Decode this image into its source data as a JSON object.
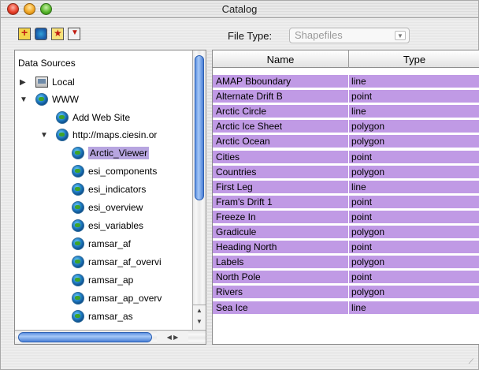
{
  "window": {
    "title": "Catalog"
  },
  "toolbar": {
    "icons": [
      "add-data-icon",
      "web-site-icon",
      "favorite-icon",
      "remove-icon"
    ],
    "file_type_label": "File Type:",
    "file_type_value": "Shapefiles"
  },
  "tree": {
    "header": "Data Sources",
    "items": [
      {
        "label": "Local",
        "depth": 0,
        "icon": "computer-icon",
        "disclosure": "collapsed"
      },
      {
        "label": "WWW",
        "depth": 0,
        "icon": "globe-icon",
        "disclosure": "expanded"
      },
      {
        "label": "Add Web Site",
        "depth": 1,
        "icon": "globe-icon",
        "disclosure": "none"
      },
      {
        "label": "http://maps.ciesin.or",
        "depth": 1,
        "icon": "globe-icon",
        "disclosure": "expanded"
      },
      {
        "label": "Arctic_Viewer",
        "depth": 2,
        "icon": "globe-icon",
        "disclosure": "none",
        "selected": true
      },
      {
        "label": "esi_components",
        "depth": 2,
        "icon": "globe-icon",
        "disclosure": "none"
      },
      {
        "label": "esi_indicators",
        "depth": 2,
        "icon": "globe-icon",
        "disclosure": "none"
      },
      {
        "label": "esi_overview",
        "depth": 2,
        "icon": "globe-icon",
        "disclosure": "none"
      },
      {
        "label": "esi_variables",
        "depth": 2,
        "icon": "globe-icon",
        "disclosure": "none"
      },
      {
        "label": "ramsar_af",
        "depth": 2,
        "icon": "globe-icon",
        "disclosure": "none"
      },
      {
        "label": "ramsar_af_overvi",
        "depth": 2,
        "icon": "globe-icon",
        "disclosure": "none"
      },
      {
        "label": "ramsar_ap",
        "depth": 2,
        "icon": "globe-icon",
        "disclosure": "none"
      },
      {
        "label": "ramsar_ap_overv",
        "depth": 2,
        "icon": "globe-icon",
        "disclosure": "none"
      },
      {
        "label": "ramsar_as",
        "depth": 2,
        "icon": "globe-icon",
        "disclosure": "none"
      }
    ]
  },
  "table": {
    "columns": [
      "Name",
      "Type"
    ],
    "rows": [
      [
        "AMAP Bboundary",
        "line"
      ],
      [
        "Alternate Drift B",
        "point"
      ],
      [
        "Arctic Circle",
        "line"
      ],
      [
        "Arctic Ice Sheet",
        "polygon"
      ],
      [
        "Arctic Ocean",
        "polygon"
      ],
      [
        "Cities",
        "point"
      ],
      [
        "Countries",
        "polygon"
      ],
      [
        "First Leg",
        "line"
      ],
      [
        "Fram's  Drift 1",
        "point"
      ],
      [
        "Freeze In",
        "point"
      ],
      [
        "Gradicule",
        "polygon"
      ],
      [
        "Heading North",
        "point"
      ],
      [
        "Labels",
        "polygon"
      ],
      [
        "North Pole",
        "point"
      ],
      [
        "Rivers",
        "polygon"
      ],
      [
        "Sea Ice",
        "line"
      ]
    ]
  },
  "colors": {
    "selection": "#c09ae5",
    "tree_selection": "#b7a5e0",
    "scroll_thumb": "#5b8fe0"
  }
}
